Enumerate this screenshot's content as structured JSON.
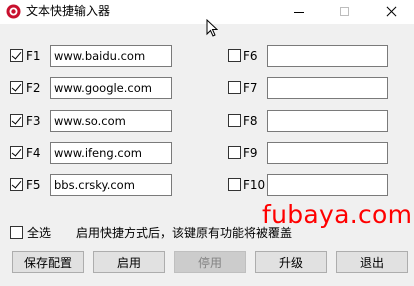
{
  "window": {
    "title": "文本快捷输入器"
  },
  "left_rows": [
    {
      "key": "F1",
      "checked": true,
      "value": "www.baidu.com"
    },
    {
      "key": "F2",
      "checked": true,
      "value": "www.google.com"
    },
    {
      "key": "F3",
      "checked": true,
      "value": "www.so.com"
    },
    {
      "key": "F4",
      "checked": true,
      "value": "www.ifeng.com"
    },
    {
      "key": "F5",
      "checked": true,
      "value": "bbs.crsky.com"
    }
  ],
  "right_rows": [
    {
      "key": "F6",
      "checked": false,
      "value": ""
    },
    {
      "key": "F7",
      "checked": false,
      "value": ""
    },
    {
      "key": "F8",
      "checked": false,
      "value": ""
    },
    {
      "key": "F9",
      "checked": false,
      "value": ""
    },
    {
      "key": "F10",
      "checked": false,
      "value": ""
    }
  ],
  "select_all": {
    "label": "全选",
    "checked": false
  },
  "hint": "启用快捷方式后，该键原有功能将被覆盖",
  "watermark": "fubaya.com",
  "buttons": {
    "save": "保存配置",
    "enable": "启用",
    "disable": "停用",
    "upgrade": "升级",
    "exit": "退出"
  },
  "colors": {
    "watermark": "#ff0000",
    "background": "#f0f0f0"
  }
}
